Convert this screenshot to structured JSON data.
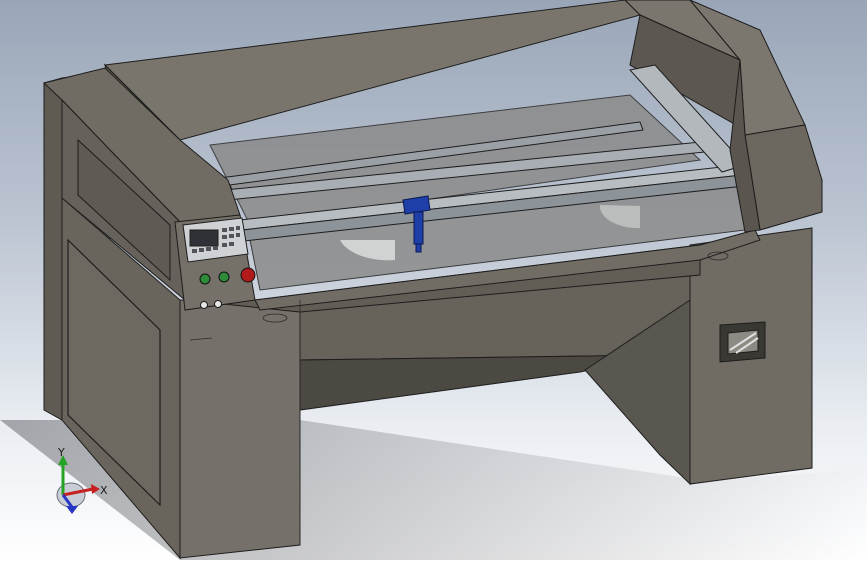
{
  "viewport": {
    "background_top": "#9aa6b8",
    "background_bottom": "#ffffff"
  },
  "model": {
    "body_color": "#6e6960",
    "edge_color": "#1d1d1d",
    "gantry_color": "#a9b0b6",
    "laser_head_color": "#1f3fa8",
    "buttons": {
      "left_button_color": "#2e8b3a",
      "middle_button_color": "#2e8b3a",
      "stop_button_color": "#b01a1a"
    }
  },
  "triad": {
    "y_label": "Y",
    "x_label": "X",
    "y_color": "#24a324",
    "x_color": "#c62020",
    "z_color": "#2535c4"
  }
}
